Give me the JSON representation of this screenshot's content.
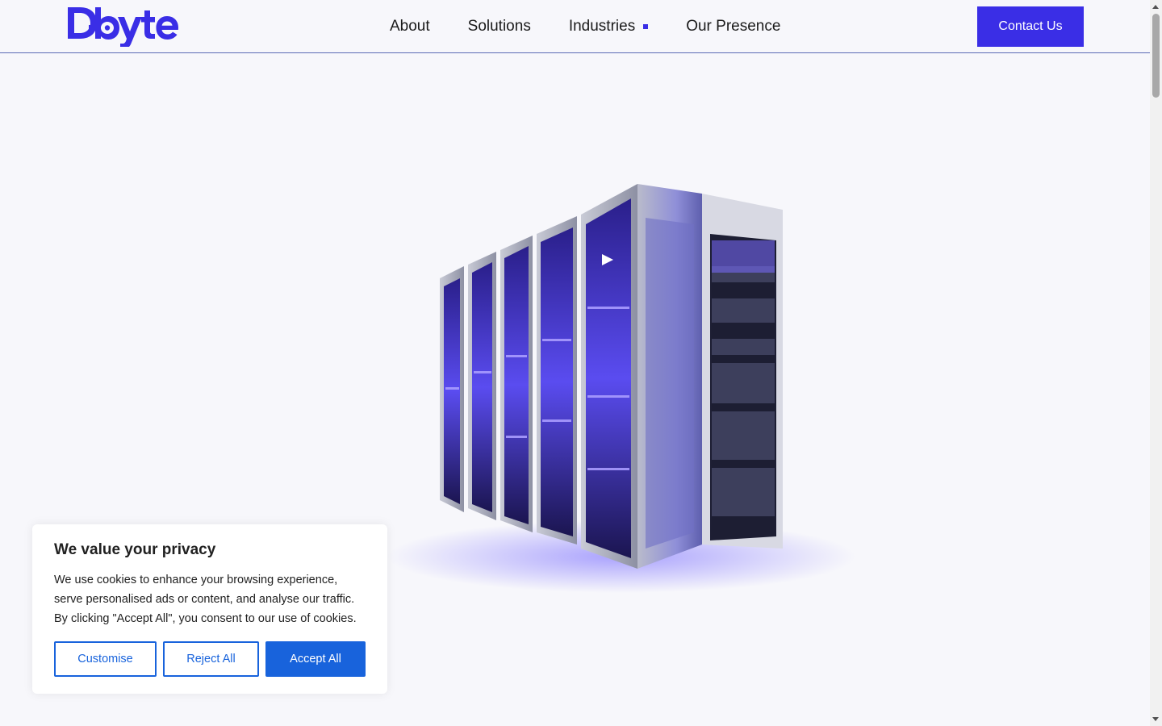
{
  "header": {
    "logo_text": "Dbyte",
    "brand_color": "#3a2ee6",
    "nav": [
      {
        "label": "About"
      },
      {
        "label": "Solutions"
      },
      {
        "label": "Industries",
        "has_dropdown": true
      },
      {
        "label": "Our Presence"
      }
    ],
    "contact_label": "Contact Us"
  },
  "hero": {
    "image": "server-racks-illustration",
    "play_icon": "play-icon"
  },
  "cookie_banner": {
    "title": "We value your privacy",
    "text": "We use cookies to enhance your browsing experience, serve personalised ads or content, and analyse our traffic. By clicking \"Accept All\", you consent to our use of cookies.",
    "customise_label": "Customise",
    "reject_label": "Reject All",
    "accept_label": "Accept All",
    "accent_color": "#1863dc"
  }
}
